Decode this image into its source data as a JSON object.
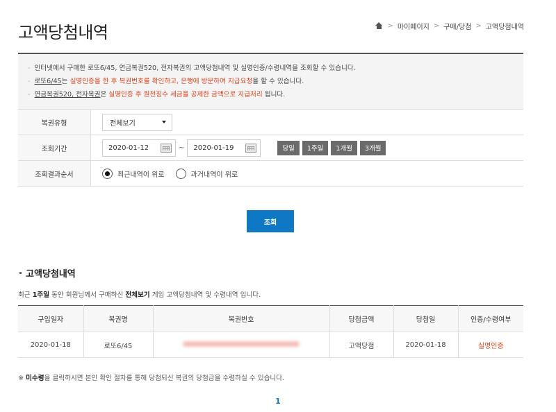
{
  "page": {
    "title": "고액당첨내역",
    "breadcrumb": [
      "마이페이지",
      "구매/당첨",
      "고액당첨내역"
    ]
  },
  "notice": {
    "line1": "인터넷에서 구매한 로또6/45, 연금복권520, 전자복권의 고액당첨내역 및 실명인증/수령내역을 조회할 수 있습니다.",
    "line2_a": "로또6/45",
    "line2_b": "는 ",
    "line2_c": "실명인증을 한 후 복권번호를 확인하고, 은행에 방문하여 지급요청",
    "line2_d": "을 할 수 있습니다.",
    "line3_a": "연금복권520, 전자복권",
    "line3_b": "은 ",
    "line3_c": "실명인증 후 원천징수 세금을 공제한 금액으로 지급처리",
    "line3_d": " 됩니다."
  },
  "form": {
    "type_label": "복권유형",
    "type_value": "전체보기",
    "period_label": "조회기간",
    "date_from": "2020-01-12",
    "date_to": "2020-01-19",
    "tilde": "~",
    "period_buttons": [
      "당일",
      "1주일",
      "1개월",
      "3개월"
    ],
    "order_label": "조회결과순서",
    "order_options": [
      "최근내역이 위로",
      "과거내역이 위로"
    ],
    "search_label": "조회"
  },
  "result": {
    "title": "고액당첨내역",
    "desc_a": "최근 ",
    "desc_period": "1주일",
    "desc_b": " 동안 회원님께서 구매하신 ",
    "desc_type": "전체보기",
    "desc_c": " 게임 고액당첨내역 및 수령내역 입니다.",
    "columns": [
      "구입일자",
      "복권명",
      "복권번호",
      "당첨금액",
      "당첨일",
      "인증/수령여부"
    ],
    "rows": [
      {
        "buy_date": "2020-01-18",
        "name": "로또6/45",
        "amount": "고액당첨",
        "win_date": "2020-01-18",
        "status": "실명인증"
      }
    ],
    "note_a": "※ ",
    "note_b": "미수령",
    "note_c": "을 클릭하시면 본인 확인 절차를 통해 당첨되신 복권의 당첨금을 수령하실 수 있습니다.",
    "page": "1"
  },
  "colors": {
    "accent_blue": "#0f78c5",
    "accent_red": "#e0401a"
  }
}
